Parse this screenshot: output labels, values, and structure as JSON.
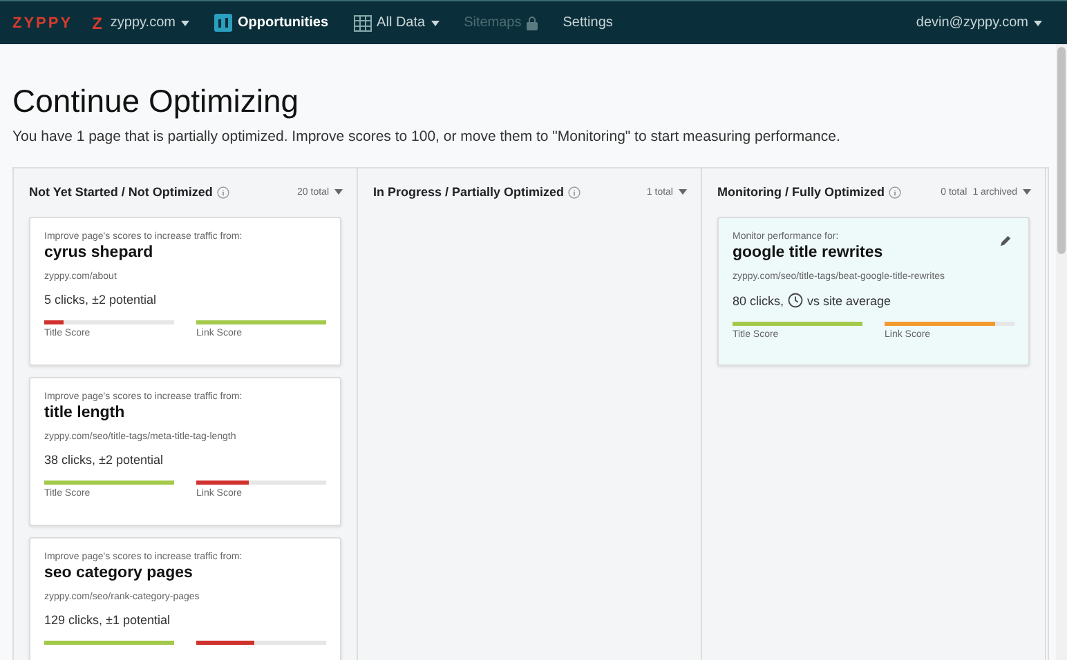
{
  "navbar": {
    "logo": "ZYPPY",
    "site": {
      "badge": "Z",
      "label": "zyppy.com"
    },
    "items": [
      {
        "label": "Opportunities",
        "kind": "chart",
        "selected": true,
        "disabled": false,
        "dropdown": false
      },
      {
        "label": "All Data",
        "kind": "grid",
        "selected": false,
        "disabled": false,
        "dropdown": true
      },
      {
        "label": "Sitemaps",
        "kind": "lock",
        "selected": false,
        "disabled": true,
        "dropdown": false
      },
      {
        "label": "Settings",
        "kind": "plain",
        "selected": false,
        "disabled": false,
        "dropdown": false
      }
    ],
    "user": "devin@zyppy.com"
  },
  "heading": "Continue Optimizing",
  "subtitle": "You have 1 page that is partially optimized. Improve scores to 100, or move them to \"Monitoring\" to start measuring performance.",
  "columns": [
    {
      "title": "Not Yet Started / Not Optimized",
      "counts": [
        "20 total"
      ],
      "cards": [
        {
          "kind": "improve",
          "intro": "Improve page's scores to increase traffic from:",
          "title": "cyrus shepard",
          "url": "zyppy.com/about",
          "metric": "5 clicks, ±2 potential",
          "scores": [
            {
              "label": "Title Score",
              "level": 0.15
            },
            {
              "label": "Link Score",
              "level": 1
            }
          ]
        },
        {
          "kind": "improve",
          "intro": "Improve page's scores to increase traffic from:",
          "title": "title length",
          "url": "zyppy.com/seo/title-tags/meta-title-tag-length",
          "metric": "38 clicks, ±2 potential",
          "scores": [
            {
              "label": "Title Score",
              "level": 1
            },
            {
              "label": "Link Score",
              "level": 0.4
            }
          ]
        },
        {
          "kind": "improve",
          "intro": "Improve page's scores to increase traffic from:",
          "title": "seo category pages",
          "url": "zyppy.com/seo/rank-category-pages",
          "metric": "129 clicks, ±1 potential",
          "scores": [
            {
              "level": 1
            },
            {
              "level": 0.45
            }
          ]
        }
      ]
    },
    {
      "title": "In Progress / Partially Optimized",
      "counts": [
        "1 total"
      ]
    },
    {
      "title": "Monitoring / Fully Optimized",
      "counts": [
        "0 total",
        "1 archived"
      ],
      "cards": [
        {
          "kind": "monitor",
          "intro": "Monitor performance for:",
          "title": "google title rewrites",
          "url": "zyppy.com/seo/title-tags/beat-google-title-rewrites",
          "metric": "80 clicks,",
          "metric_after": "vs site average",
          "scores": [
            {
              "label": "Title Score",
              "level": 1
            },
            {
              "label": "Link Score",
              "level": 0.85
            }
          ]
        }
      ]
    }
  ]
}
